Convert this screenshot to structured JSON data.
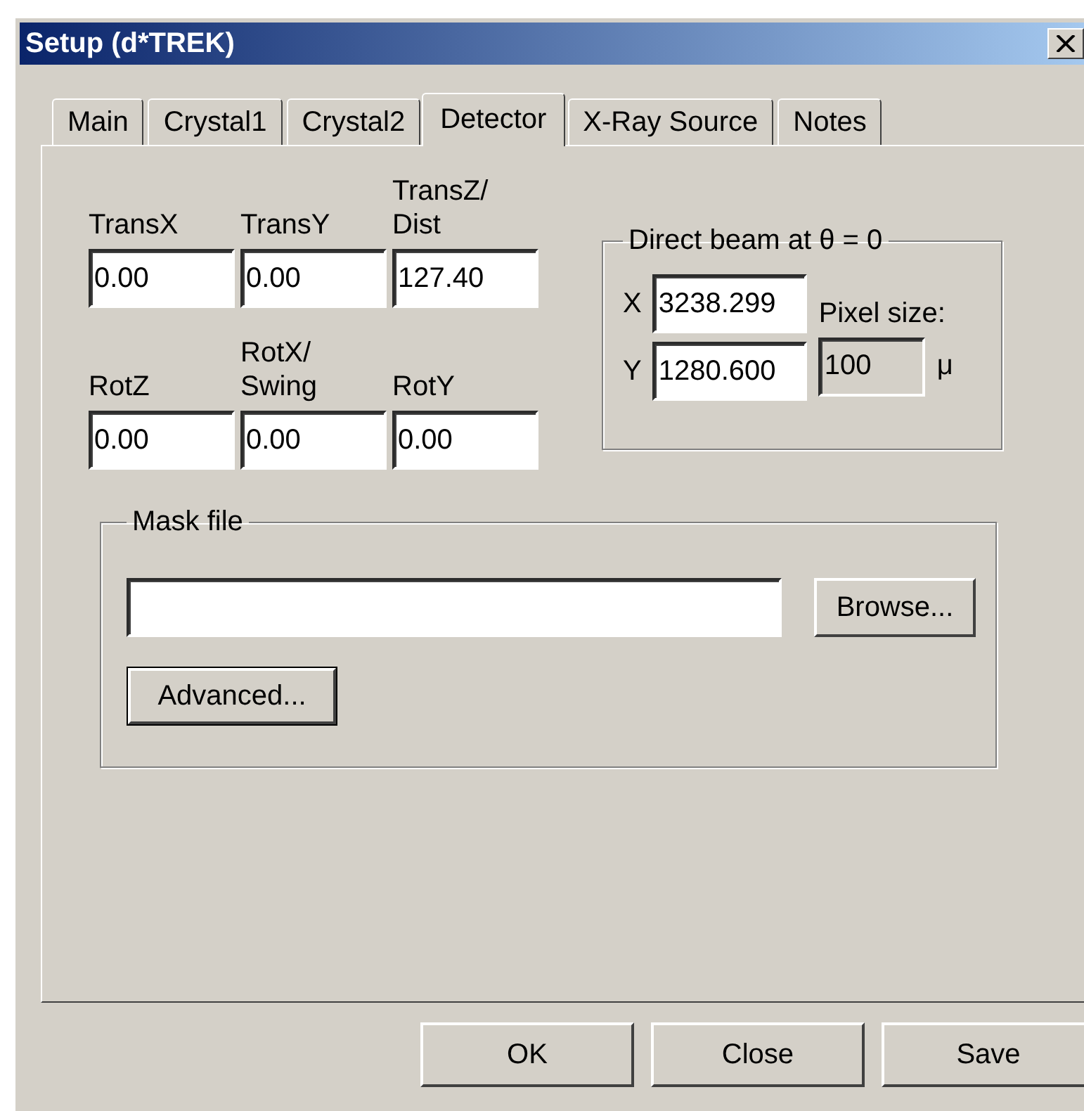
{
  "window": {
    "title": "Setup (d*TREK)"
  },
  "tabs": [
    {
      "label": "Main",
      "selected": false
    },
    {
      "label": "Crystal1",
      "selected": false
    },
    {
      "label": "Crystal2",
      "selected": false
    },
    {
      "label": "Detector",
      "selected": true
    },
    {
      "label": "X-Ray Source",
      "selected": false
    },
    {
      "label": "Notes",
      "selected": false
    }
  ],
  "fields": [
    {
      "label": "TransX",
      "value": "0.00"
    },
    {
      "label": "TransY",
      "value": "0.00"
    },
    {
      "label": "TransZ/ Dist",
      "value": "127.40"
    },
    {
      "label": "RotZ",
      "value": "0.00"
    },
    {
      "label": "RotX/ Swing",
      "value": "0.00"
    },
    {
      "label": "RotY",
      "value": "0.00"
    }
  ],
  "direct_beam": {
    "title": "Direct beam at θ = 0",
    "x_label": "X",
    "x_value": "3238.299",
    "y_label": "Y",
    "y_value": "1280.600",
    "pixel_size_label": "Pixel size:",
    "pixel_size_value": "100",
    "pixel_size_disabled": true,
    "pixel_size_unit": "μ"
  },
  "mask_file": {
    "title": "Mask file",
    "browse_button": "Browse...",
    "advanced_button": "Advanced...",
    "advanced_default": true
  },
  "buttons": [
    "OK",
    "Close",
    "Save"
  ]
}
